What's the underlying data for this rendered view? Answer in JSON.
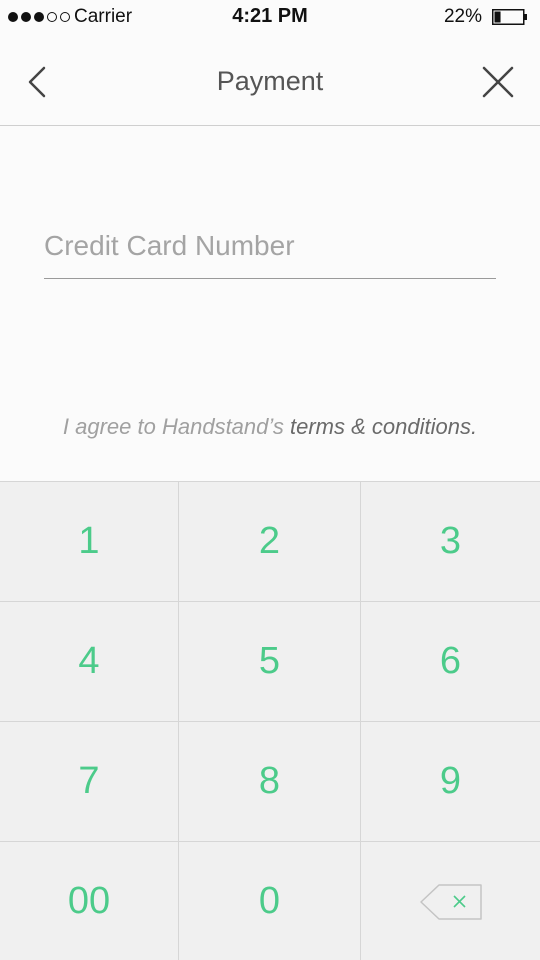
{
  "status_bar": {
    "carrier": "Carrier",
    "time": "4:21 PM",
    "battery": "22%",
    "battery_level": 0.22
  },
  "nav": {
    "title": "Payment",
    "back_icon": "chevron-left-icon",
    "close_icon": "close-icon"
  },
  "form": {
    "card_placeholder": "Credit Card Number",
    "card_value": ""
  },
  "terms": {
    "prefix": "I agree to Handstand’s ",
    "link": "terms & conditions."
  },
  "keypad": {
    "accent": "#4ccb8a",
    "keys": [
      "1",
      "2",
      "3",
      "4",
      "5",
      "6",
      "7",
      "8",
      "9",
      "00",
      "0"
    ],
    "backspace_icon": "backspace-icon"
  }
}
